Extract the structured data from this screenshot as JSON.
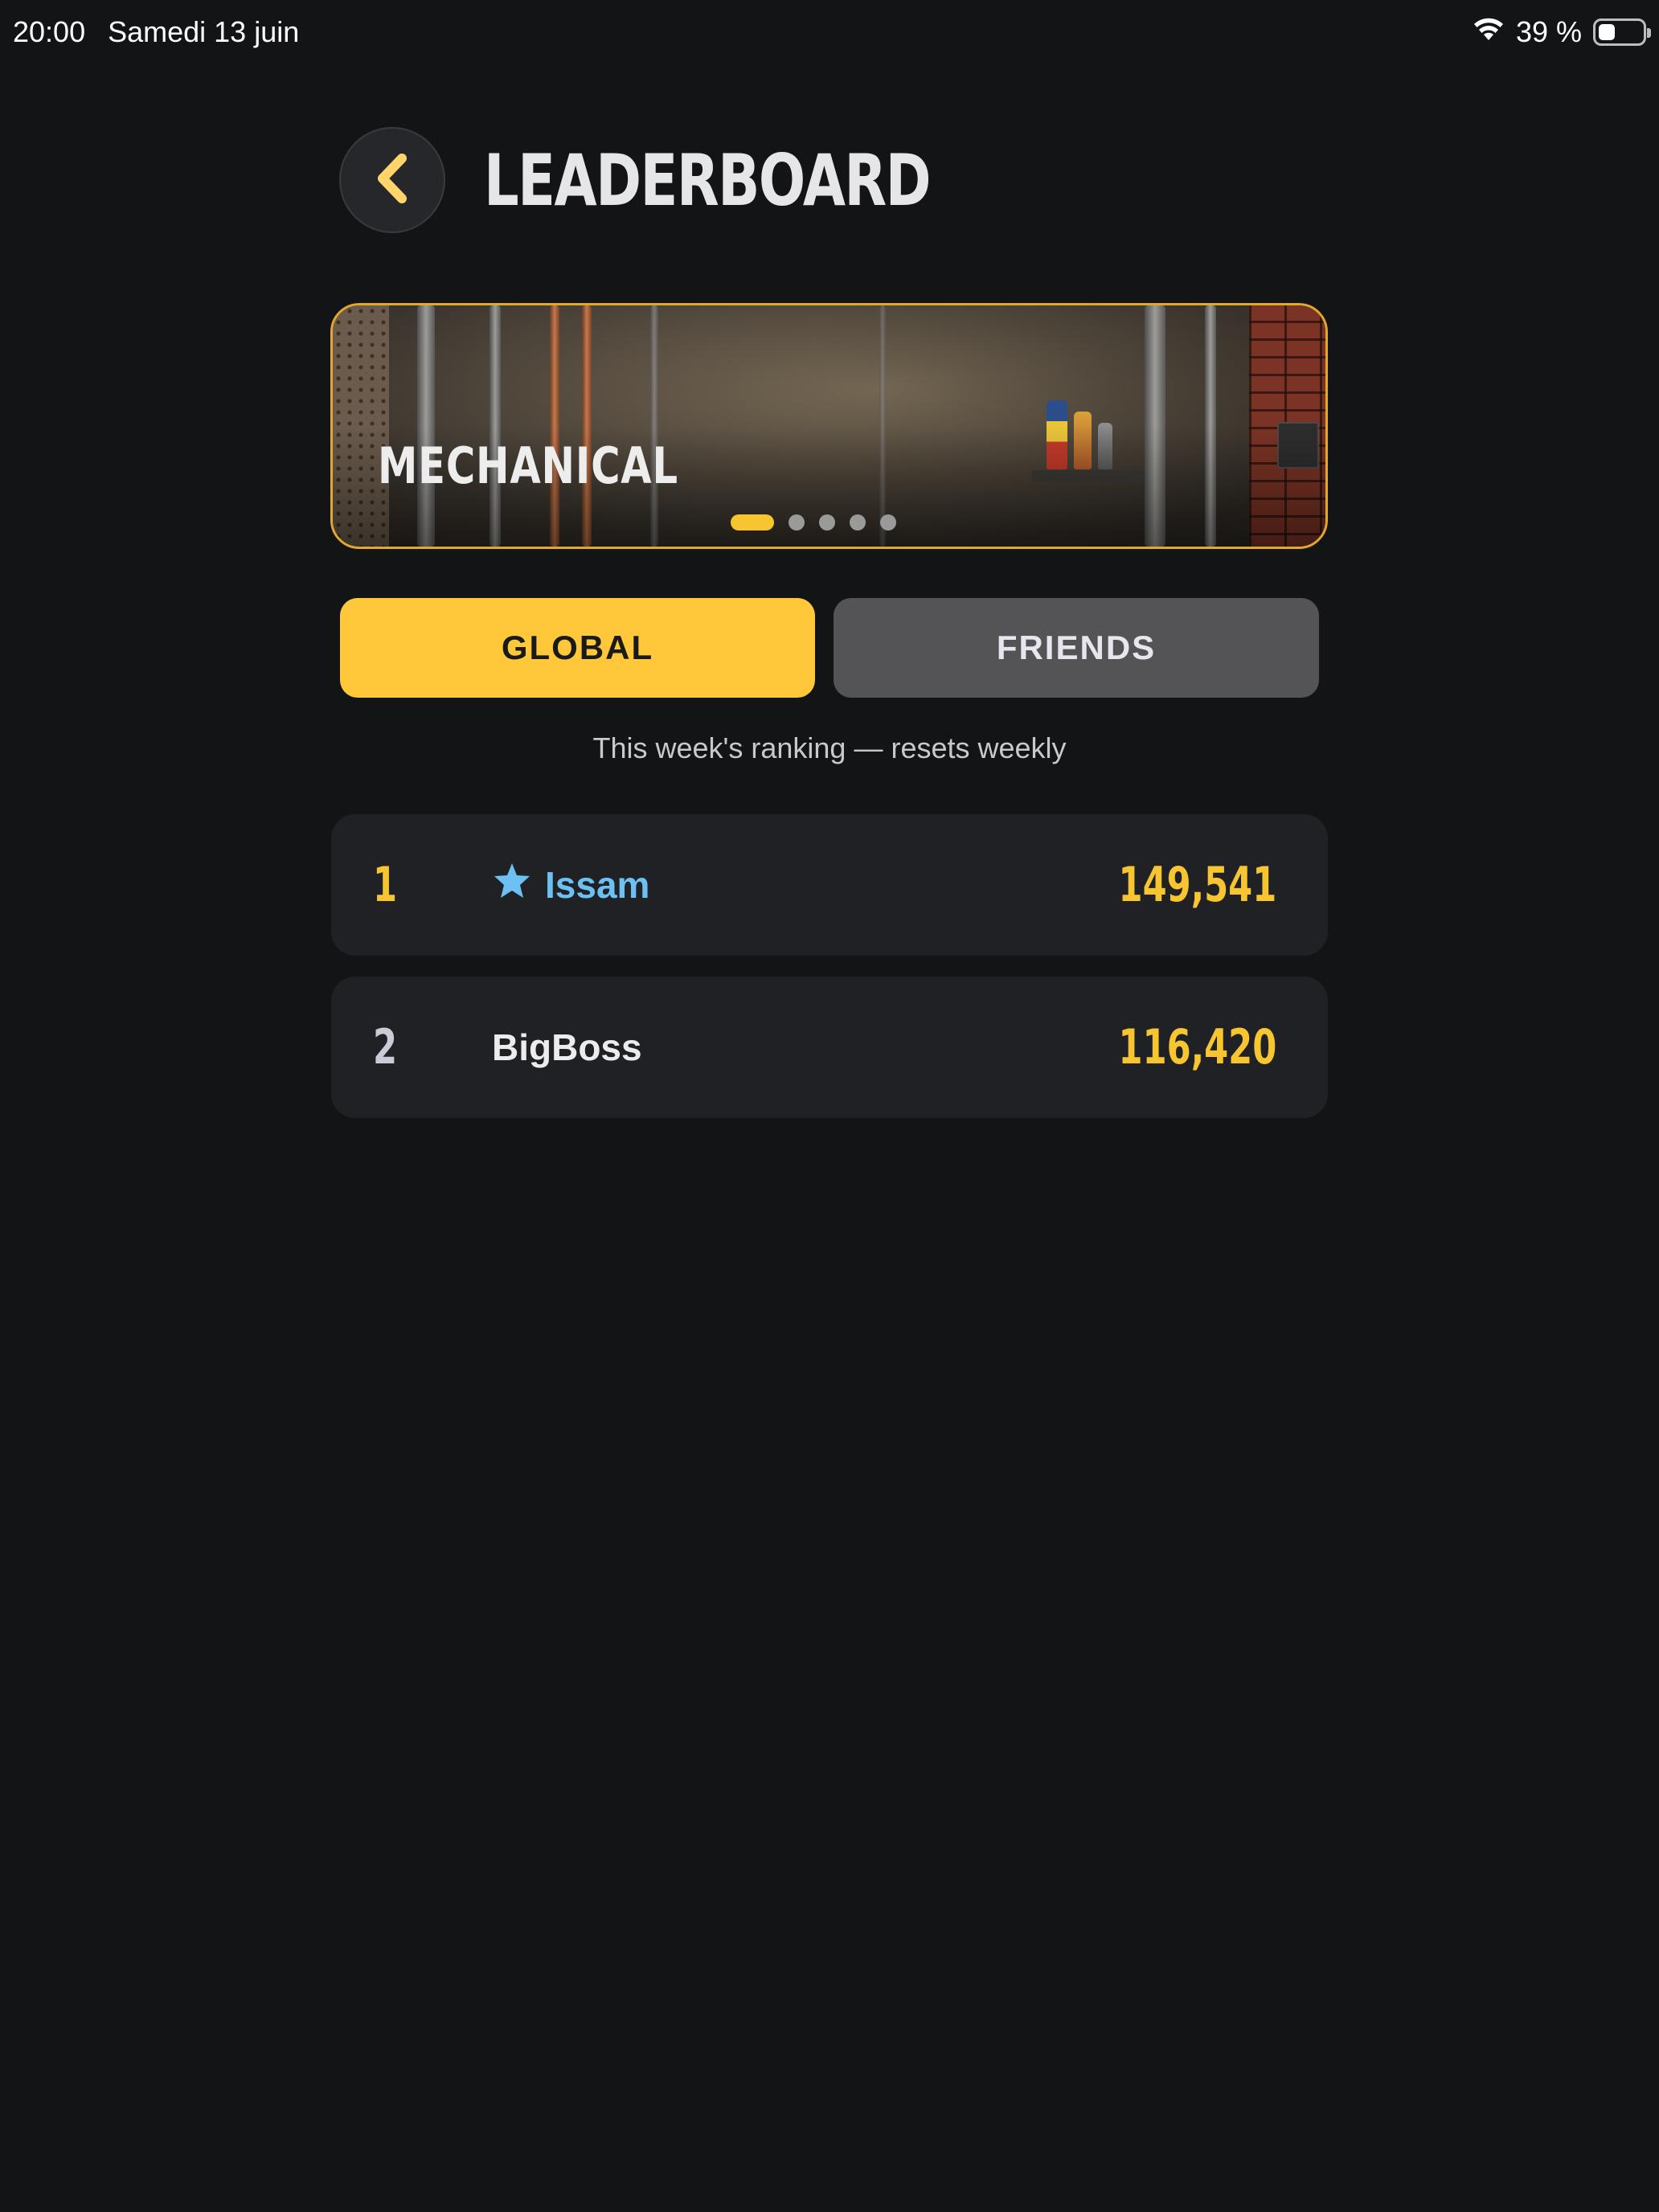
{
  "status_bar": {
    "time": "20:00",
    "date": "Samedi 13 juin",
    "battery_percent": "39 %",
    "battery_level": 0.39,
    "icons": [
      "wifi-icon",
      "battery-icon"
    ]
  },
  "header": {
    "title": "LEADERBOARD",
    "back_icon": "chevron-left-icon"
  },
  "banner": {
    "label": "MECHANICAL",
    "slide_count": 5,
    "active_slide": 1
  },
  "tabs": [
    {
      "label": "GLOBAL",
      "selected": true
    },
    {
      "label": "FRIENDS",
      "selected": false
    }
  ],
  "subtitle": "This week's ranking — resets weekly",
  "leaderboard": [
    {
      "rank": "1",
      "name": "Issam",
      "score": "149,541",
      "is_current_user": true,
      "icon": "star-icon"
    },
    {
      "rank": "2",
      "name": "BigBoss",
      "score": "116,420",
      "is_current_user": false
    }
  ],
  "colors": {
    "background": "#131416",
    "accent_yellow": "#ffc83a",
    "score_yellow": "#f7c530",
    "current_user_blue": "#6cc1f2",
    "row_background": "#202124"
  }
}
